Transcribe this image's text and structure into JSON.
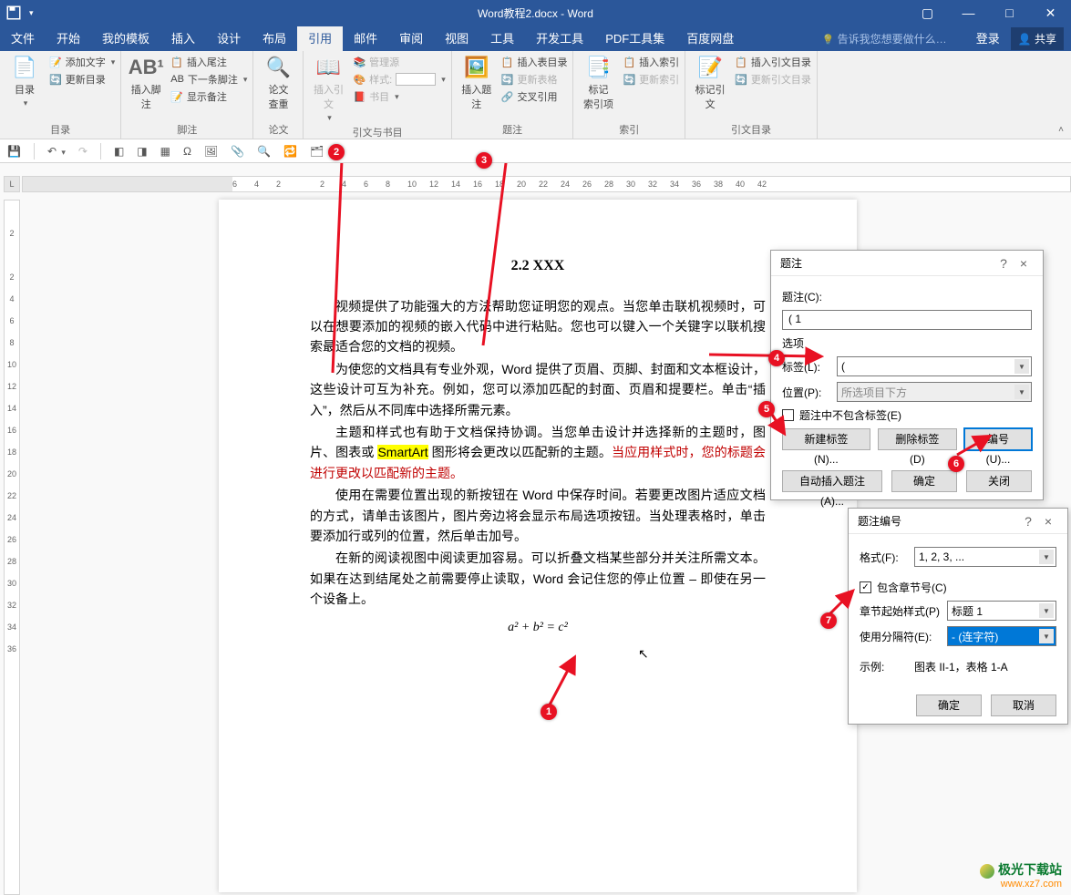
{
  "titlebar": {
    "title": "Word教程2.docx - Word"
  },
  "window_controls": {
    "ribbon_opts": "▢",
    "minimize": "—",
    "maximize": "□",
    "close": "✕"
  },
  "tabs": {
    "file": "文件",
    "home": "开始",
    "mytpl": "我的模板",
    "insert": "插入",
    "design": "设计",
    "layout": "布局",
    "references": "引用",
    "mail": "邮件",
    "review": "审阅",
    "view": "视图",
    "tools": "工具",
    "dev": "开发工具",
    "pdf": "PDF工具集",
    "baidu": "百度网盘",
    "tellme": "告诉我您想要做什么…",
    "login": "登录",
    "share": "共享"
  },
  "ribbon": {
    "toc": {
      "big": "目录",
      "add_text": "添加文字",
      "update_toc": "更新目录",
      "group": "目录"
    },
    "foot": {
      "big": "插入脚注",
      "ab": "AB¹",
      "insert_endnote": "插入尾注",
      "next": "下一条脚注",
      "show": "显示备注",
      "group": "脚注"
    },
    "thesis": {
      "big": "论文\n查重",
      "group": "论文"
    },
    "cite": {
      "big": "插入引文",
      "manage": "管理源",
      "style_l": "样式:",
      "bib": "书目",
      "group": "引文与书目"
    },
    "caption": {
      "big": "插入题注",
      "ins_fig": "插入表目录",
      "update_table": "更新表格",
      "cross": "交叉引用",
      "group": "题注"
    },
    "index": {
      "big": "标记\n索引项",
      "ins_idx": "插入索引",
      "upd_idx": "更新索引",
      "group": "索引"
    },
    "cit2": {
      "big": "标记引文",
      "ins_cit": "插入引文目录",
      "upd_cit": "更新引文目录",
      "group": "引文目录"
    }
  },
  "ruler_h": [
    "6",
    "4",
    "2",
    "",
    "2",
    "4",
    "6",
    "8",
    "10",
    "12",
    "14",
    "16",
    "18",
    "20",
    "22",
    "24",
    "26",
    "28",
    "30",
    "32",
    "34",
    "36",
    "38",
    "40",
    "42"
  ],
  "ruler_v": [
    "",
    "2",
    "",
    "2",
    "4",
    "6",
    "8",
    "10",
    "12",
    "14",
    "16",
    "18",
    "20",
    "22",
    "24",
    "26",
    "28",
    "30",
    "32",
    "34",
    "36"
  ],
  "doc": {
    "heading": "2.2 XXX",
    "p1": "视频提供了功能强大的方法帮助您证明您的观点。当您单击联机视频时，可以在想要添加的视频的嵌入代码中进行粘贴。您也可以键入一个关键字以联机搜索最适合您的文档的视频。",
    "p2a": "为使您的文档具有专业外观，Word 提供了页眉、页脚、封面和文本框设计，这些设计可互为补充。例如，您可以添加匹配的封面、页眉和提要栏。单击“插入”，然后从不同库中选择所需元素。",
    "p3a": "主题和样式也有助于文档保持协调。当您单击设计并选择新的主题时，图片、图表或 ",
    "p3b": "SmartArt",
    "p3c": " 图形将会更改以匹配新的主题。",
    "p3d": "当应用样式时，您的标题会进行更改以匹配新的主题。",
    "p4": "使用在需要位置出现的新按钮在 Word 中保存时间。若要更改图片适应文档的方式，请单击该图片，图片旁边将会显示布局选项按钮。当处理表格时，单击要添加行或列的位置，然后单击加号。",
    "p5": "在新的阅读视图中阅读更加容易。可以折叠文档某些部分并关注所需文本。如果在达到结尾处之前需要停止读取，Word 会记住您的停止位置 – 即使在另一个设备上。",
    "formula": "a² + b² = c²"
  },
  "dialog1": {
    "title": "题注",
    "help": "?",
    "close": "×",
    "caption_l": "题注(C):",
    "caption_v": "( 1",
    "options": "选项",
    "label_l": "标签(L):",
    "label_v": "(",
    "pos_l": "位置(P):",
    "pos_v": "所选项目下方",
    "exclude": "题注中不包含标签(E)",
    "new_label": "新建标签(N)...",
    "del_label": "删除标签(D)",
    "numbering": "编号(U)...",
    "auto": "自动插入题注(A)...",
    "ok": "确定",
    "close_btn": "关闭"
  },
  "dialog2": {
    "title": "题注编号",
    "help": "?",
    "close": "×",
    "format_l": "格式(F):",
    "format_v": "1, 2, 3, ...",
    "include": "包含章节号(C)",
    "chapstyle_l": "章节起始样式(P)",
    "chapstyle_v": "标题 1",
    "sep_l": "使用分隔符(E):",
    "sep_v": "- (连字符)",
    "example_l": "示例:",
    "example_v": "图表 II-1，表格 1-A",
    "ok": "确定",
    "cancel": "取消"
  },
  "badges": {
    "b1": "1",
    "b2": "2",
    "b3": "3",
    "b4": "4",
    "b5": "5",
    "b6": "6",
    "b7": "7"
  },
  "watermark": {
    "line1": "极光下载站",
    "line2": "www.xz7.com"
  }
}
